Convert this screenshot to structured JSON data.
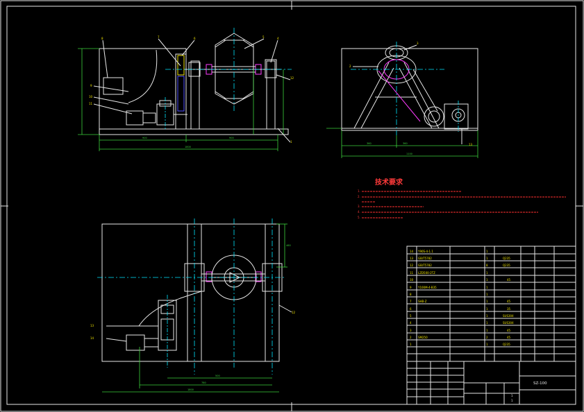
{
  "tech": {
    "title": "技术要求",
    "notes": [
      "1.",
      "2.",
      "3.",
      "4.",
      "5.",
      "6."
    ]
  },
  "bom": {
    "rows": [
      {
        "no": "14",
        "code": "Y90S-4-1.1",
        "name": "",
        "qty": "1",
        "mat": "",
        "note": ""
      },
      {
        "no": "13",
        "code": "GB/T5782",
        "name": "",
        "qty": "1",
        "mat": "Q235",
        "note": ""
      },
      {
        "no": "12",
        "code": "GB/T5782",
        "name": "",
        "qty": "8",
        "mat": "Q235",
        "note": ""
      },
      {
        "no": "11",
        "code": "LZD500-2TZ",
        "name": "",
        "qty": "1",
        "mat": "",
        "note": ""
      },
      {
        "no": "10",
        "code": "",
        "name": "",
        "qty": "1",
        "mat": "45",
        "note": ""
      },
      {
        "no": "9",
        "code": "Y100M-4-B35",
        "name": "",
        "qty": "1",
        "mat": "",
        "note": ""
      },
      {
        "no": "8",
        "code": "",
        "name": "",
        "qty": "1",
        "mat": "",
        "note": ""
      },
      {
        "no": "7",
        "code": "SHB-Z",
        "name": "",
        "qty": "1",
        "mat": "45",
        "note": ""
      },
      {
        "no": "6",
        "code": "",
        "name": "",
        "qty": "1",
        "mat": "35",
        "note": ""
      },
      {
        "no": "5",
        "code": "",
        "name": "",
        "qty": "1",
        "mat": "SUS304",
        "note": ""
      },
      {
        "no": "4",
        "code": "",
        "name": "",
        "qty": "1",
        "mat": "SUS304",
        "note": ""
      },
      {
        "no": "3",
        "code": "",
        "name": "",
        "qty": "1",
        "mat": "45",
        "note": ""
      },
      {
        "no": "2",
        "code": "SM250",
        "name": "",
        "qty": "2",
        "mat": "45",
        "note": ""
      },
      {
        "no": "1",
        "code": "",
        "name": "",
        "qty": "1",
        "mat": "Q235",
        "note": ""
      }
    ]
  },
  "title_block": {
    "drawing_name": "SZ-100",
    "scale": "1",
    "sheet": "1"
  },
  "colors": {
    "background": "#000000",
    "outline": "#e8e8e8",
    "centerline": "#00e5ff",
    "dimension": "#3cd23c",
    "hatch": "#ff3cff",
    "text_red": "#ff3a3a",
    "text_yellow": "#f2e600"
  }
}
